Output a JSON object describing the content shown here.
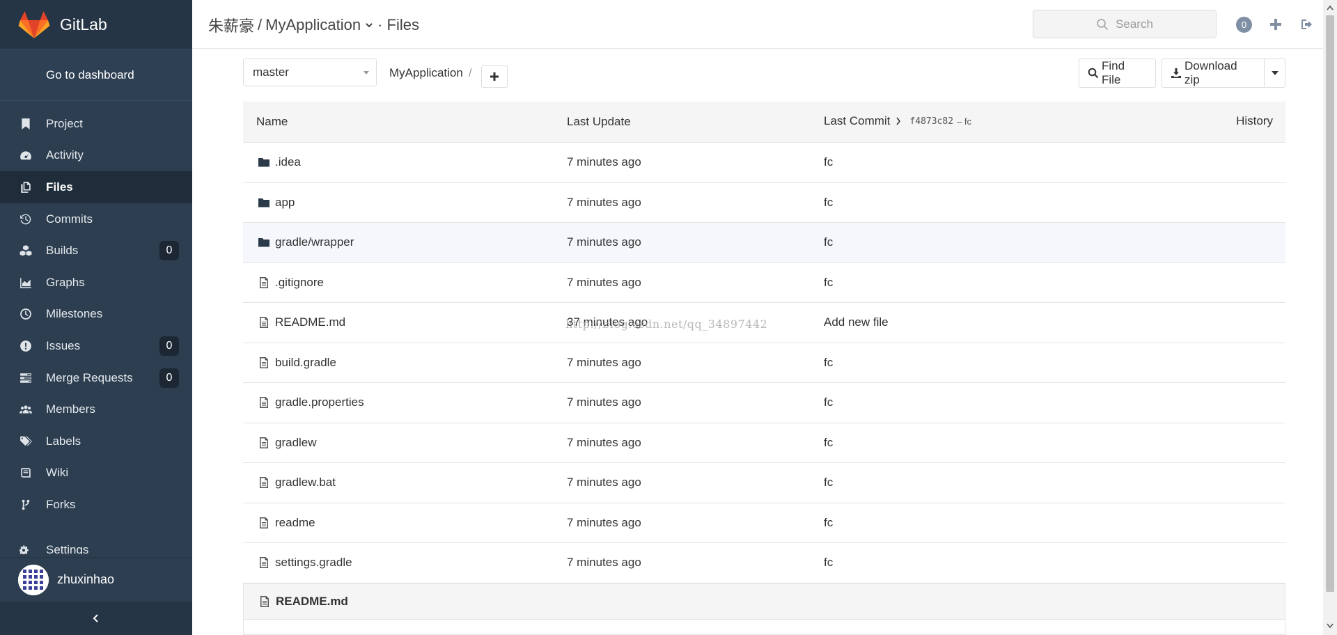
{
  "brand": {
    "name": "GitLab"
  },
  "sidebar": {
    "dashboard_link": "Go to dashboard",
    "items": [
      {
        "label": "Project",
        "icon": "bookmark-icon"
      },
      {
        "label": "Activity",
        "icon": "dashboard-icon"
      },
      {
        "label": "Files",
        "icon": "files-icon",
        "active": true
      },
      {
        "label": "Commits",
        "icon": "history-icon"
      },
      {
        "label": "Builds",
        "icon": "cubes-icon",
        "count": "0"
      },
      {
        "label": "Graphs",
        "icon": "area-chart-icon"
      },
      {
        "label": "Milestones",
        "icon": "clock-icon"
      },
      {
        "label": "Issues",
        "icon": "exclamation-circle-icon",
        "count": "0"
      },
      {
        "label": "Merge Requests",
        "icon": "tasks-icon",
        "count": "0"
      },
      {
        "label": "Members",
        "icon": "users-icon"
      },
      {
        "label": "Labels",
        "icon": "tags-icon"
      },
      {
        "label": "Wiki",
        "icon": "book-icon"
      },
      {
        "label": "Forks",
        "icon": "code-fork-icon"
      },
      {
        "label": "Settings",
        "icon": "cogs-icon"
      }
    ],
    "user": {
      "name": "zhuxinhao"
    }
  },
  "header": {
    "owner": "朱薪豪",
    "separator": "/",
    "project": "MyApplication",
    "section": "· Files",
    "search_placeholder": "Search",
    "todo_count": "0"
  },
  "toolbar": {
    "branch": "master",
    "path_root": "MyApplication",
    "path_sep": "/",
    "find_file": "Find File",
    "download_zip": "Download zip"
  },
  "table": {
    "headers": {
      "name": "Name",
      "last_update": "Last Update",
      "last_commit": "Last Commit",
      "history": "History"
    },
    "last_commit_sha": "f4873c82",
    "last_commit_msg": "– fc",
    "rows": [
      {
        "name": ".idea",
        "type": "folder",
        "updated": "7 minutes ago",
        "commit": "fc"
      },
      {
        "name": "app",
        "type": "folder",
        "updated": "7 minutes ago",
        "commit": "fc"
      },
      {
        "name": "gradle/wrapper",
        "type": "folder",
        "updated": "7 minutes ago",
        "commit": "fc"
      },
      {
        "name": ".gitignore",
        "type": "file",
        "updated": "7 minutes ago",
        "commit": "fc"
      },
      {
        "name": "README.md",
        "type": "file",
        "updated": "37 minutes ago",
        "commit": "Add new file"
      },
      {
        "name": "build.gradle",
        "type": "file",
        "updated": "7 minutes ago",
        "commit": "fc"
      },
      {
        "name": "gradle.properties",
        "type": "file",
        "updated": "7 minutes ago",
        "commit": "fc"
      },
      {
        "name": "gradlew",
        "type": "file",
        "updated": "7 minutes ago",
        "commit": "fc"
      },
      {
        "name": "gradlew.bat",
        "type": "file",
        "updated": "7 minutes ago",
        "commit": "fc"
      },
      {
        "name": "readme",
        "type": "file",
        "updated": "7 minutes ago",
        "commit": "fc"
      },
      {
        "name": "settings.gradle",
        "type": "file",
        "updated": "7 minutes ago",
        "commit": "fc"
      }
    ]
  },
  "readme": {
    "title": "README.md"
  },
  "watermark": "http://blog.csdn.net/qq_34897442",
  "colors": {
    "sidebar": "#2c3e50",
    "sidebar_dark": "#253545",
    "logo_orange": "#fc6d26",
    "logo_red": "#e24329"
  }
}
